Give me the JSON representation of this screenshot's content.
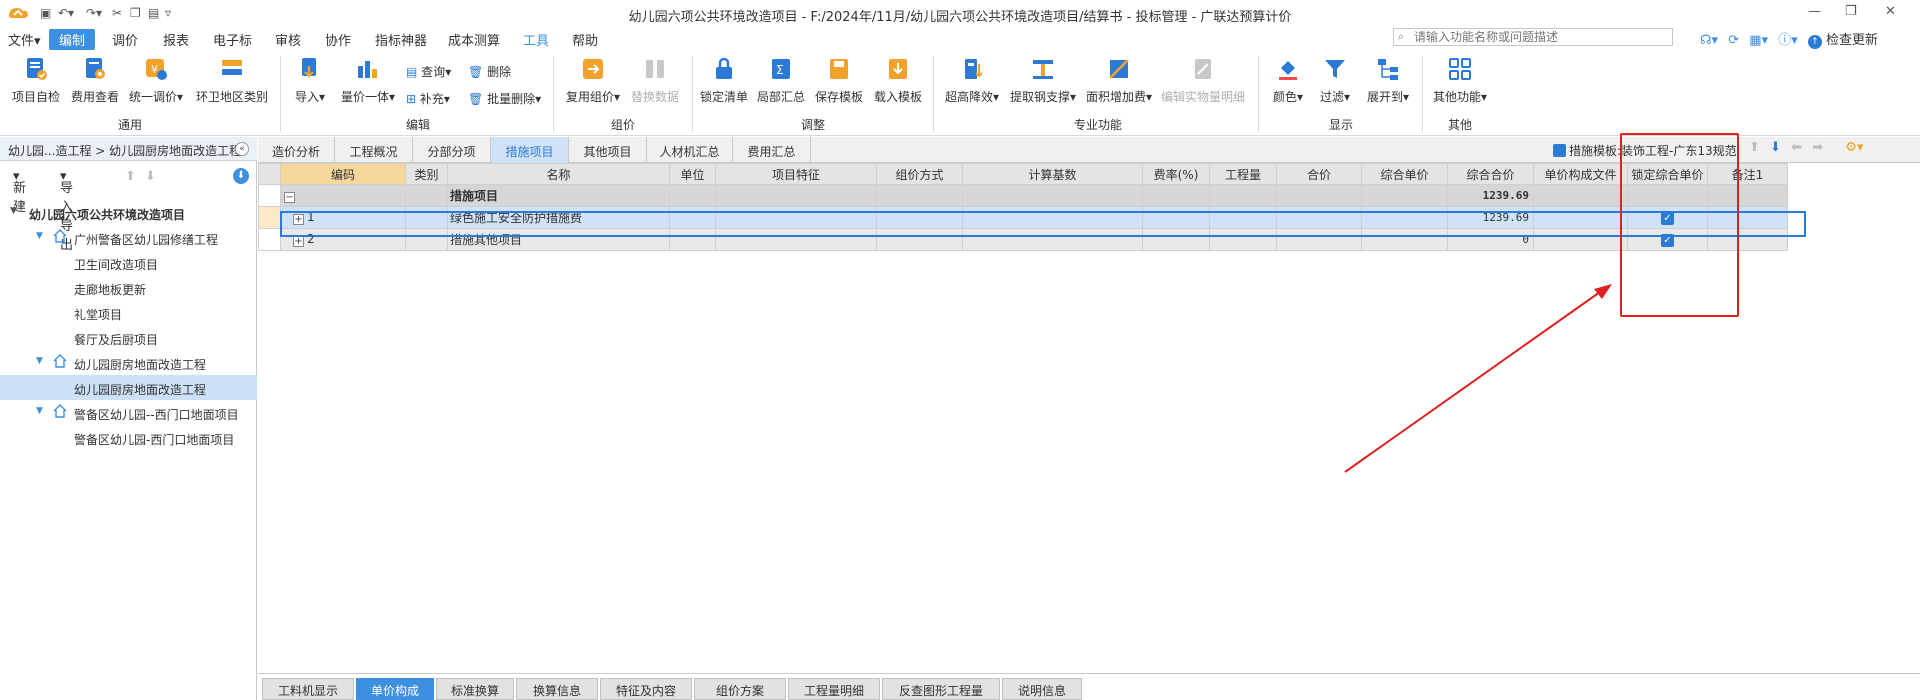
{
  "window": {
    "title": "幼儿园六项公共环境改造项目 - F:/2024年/11月/幼儿园六项公共环境改造项目/结算书 - 投标管理 - 广联达预算计价"
  },
  "menubar": {
    "items": [
      "文件",
      "编制",
      "调价",
      "报表",
      "电子标",
      "审核",
      "协作",
      "指标神器",
      "成本测算",
      "工具",
      "帮助"
    ],
    "active": "编制",
    "search_placeholder": "请输入功能名称或问题描述",
    "check_update": "检查更新"
  },
  "ribbon": {
    "general": {
      "group": "通用",
      "items": [
        "项目自检",
        "费用查看",
        "统一调价",
        "环卫地区类别"
      ]
    },
    "edit": {
      "group": "编辑",
      "items": [
        "导入",
        "量价一体",
        "查询",
        "补充",
        "删除",
        "批量删除"
      ]
    },
    "pricing": {
      "group": "组价",
      "items": [
        "复用组价",
        "替换数据"
      ]
    },
    "adjust": {
      "group": "调整",
      "items": [
        "锁定清单",
        "局部汇总",
        "保存模板",
        "载入模板"
      ]
    },
    "special": {
      "group": "专业功能",
      "items": [
        "超高降效",
        "提取钢支撑",
        "面积增加费",
        "编辑实物量明细"
      ]
    },
    "display": {
      "group": "显示",
      "items": [
        "颜色",
        "过滤",
        "展开到"
      ]
    },
    "other": {
      "group": "其他",
      "items": [
        "其他功能"
      ]
    }
  },
  "leftpanel": {
    "breadcrumb": "幼儿园...造工程 > 幼儿园厨房地面改造工程",
    "new_label": "新建",
    "import_export_label": "导入导出",
    "tree": [
      {
        "label": "幼儿园六项公共环境改造项目",
        "level": 0,
        "expanded": true
      },
      {
        "label": "广州警备区幼儿园修缮工程",
        "level": 1,
        "expanded": true
      },
      {
        "label": "卫生间改造项目",
        "level": 2
      },
      {
        "label": "走廊地板更新",
        "level": 2
      },
      {
        "label": "礼堂项目",
        "level": 2
      },
      {
        "label": "餐厅及后厨项目",
        "level": 2
      },
      {
        "label": "幼儿园厨房地面改造工程",
        "level": 1,
        "expanded": true
      },
      {
        "label": "幼儿园厨房地面改造工程",
        "level": 2,
        "selected": true
      },
      {
        "label": "警备区幼儿园--西门口地面项目",
        "level": 1,
        "expanded": true
      },
      {
        "label": "警备区幼儿园-西门口地面项目",
        "level": 2
      }
    ]
  },
  "tabs": {
    "items": [
      "造价分析",
      "工程概况",
      "分部分项",
      "措施项目",
      "其他项目",
      "人材机汇总",
      "费用汇总"
    ],
    "active": "措施项目",
    "template_label": "措施模板:装饰工程-广东13规范"
  },
  "grid": {
    "columns": [
      "编码",
      "类别",
      "名称",
      "单位",
      "项目特征",
      "组价方式",
      "计算基数",
      "费率(%)",
      "工程量",
      "合价",
      "综合单价",
      "综合合价",
      "单价构成文件",
      "锁定综合单价",
      "备注1"
    ],
    "rows": [
      {
        "code": "",
        "name": "措施项目",
        "total": "1239.69",
        "type": "header"
      },
      {
        "code": "1",
        "name": "绿色施工安全防护措施费",
        "total": "1239.69",
        "locked": true,
        "selected": true
      },
      {
        "code": "2",
        "name": "措施其他项目",
        "total": "0",
        "locked": true
      }
    ]
  },
  "bottom_tabs": {
    "items": [
      "工料机显示",
      "单价构成",
      "标准换算",
      "换算信息",
      "特征及内容",
      "组价方案",
      "工程量明细",
      "反查图形工程量",
      "说明信息"
    ],
    "active": "单价构成"
  },
  "colors": {
    "accent": "#3d8fe0",
    "selection": "#cfe2f7",
    "annotation": "#e02020",
    "code_header": "#f7d89a"
  }
}
